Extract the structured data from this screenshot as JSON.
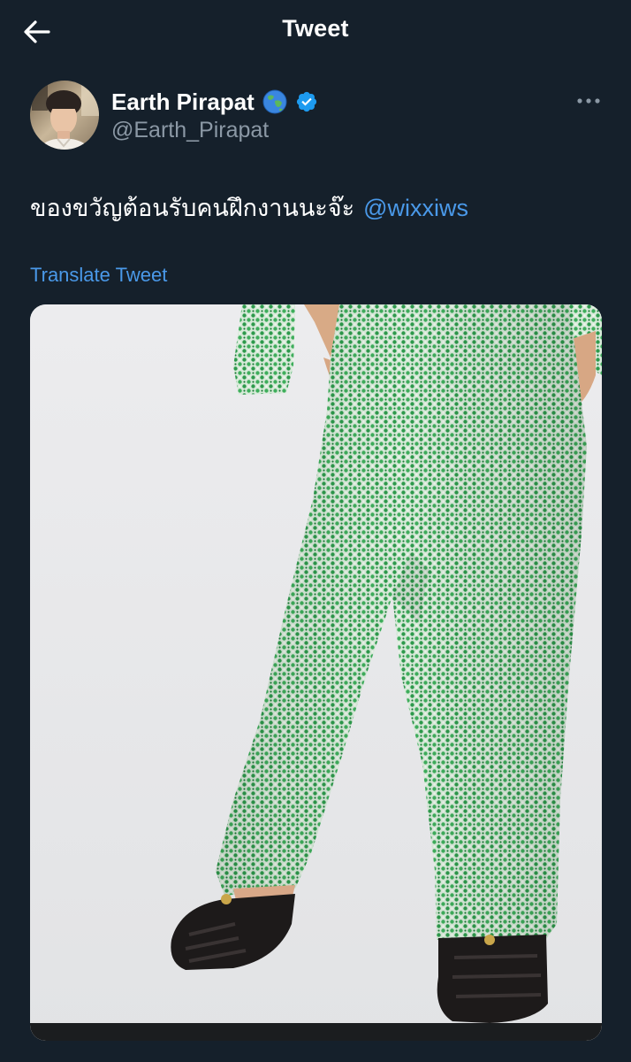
{
  "header": {
    "title": "Tweet",
    "back_icon": "arrow-left-icon"
  },
  "author": {
    "display_name": "Earth Pirapat",
    "handle": "@Earth_Pirapat",
    "name_emoji": "globe-asia-australia-emoji",
    "verified_icon": "verified-badge-icon",
    "more_icon": "more-horizontal-icon"
  },
  "tweet": {
    "text": "ของขวัญต้อนรับคนฝึกงานนะจ๊ะ",
    "mention": "@wixxiws",
    "translate_label": "Translate Tweet"
  },
  "media": {
    "kind": "photo",
    "subject": "green tweed trousers with black sandals"
  },
  "colors": {
    "background": "#15202b",
    "text_primary": "#ffffff",
    "text_secondary": "#8b98a5",
    "link": "#4a99e9",
    "verified": "#1d9bf0"
  }
}
